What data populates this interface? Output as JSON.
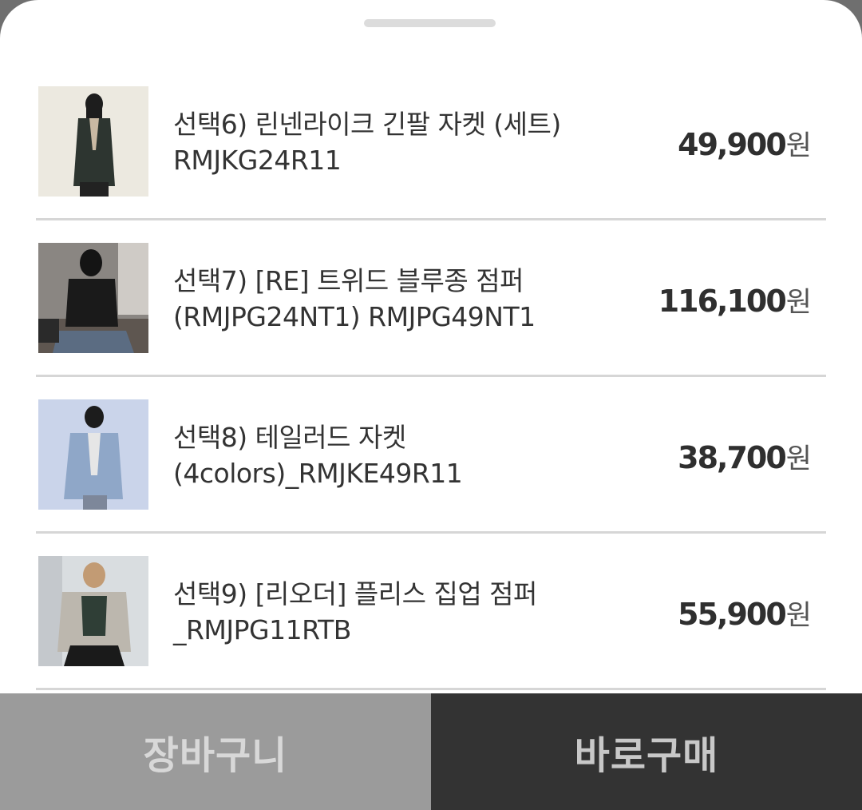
{
  "products": [
    {
      "name": "선택6) 린넨라이크 긴팔 자켓 (세트) RMJKG24R11",
      "price": "49,900",
      "unit": "원",
      "image": "woman-dark-blazer-photo"
    },
    {
      "name": "선택7) [RE] 트위드 블루종 점퍼 (RMJPG24NT1) RMJPG49NT1",
      "price": "116,100",
      "unit": "원",
      "image": "woman-black-jumper-photo"
    },
    {
      "name": "선택8) 테일러드 자켓 (4colors)_RMJKE49R11",
      "price": "38,700",
      "unit": "원",
      "image": "woman-blue-jacket-photo"
    },
    {
      "name": "선택9) [리오더] 플리스 집업 점퍼 _RMJPG11RTB",
      "price": "55,900",
      "unit": "원",
      "image": "woman-fleece-jumper-photo"
    }
  ],
  "footer": {
    "cart_label": "장바구니",
    "buy_label": "바로구매"
  }
}
